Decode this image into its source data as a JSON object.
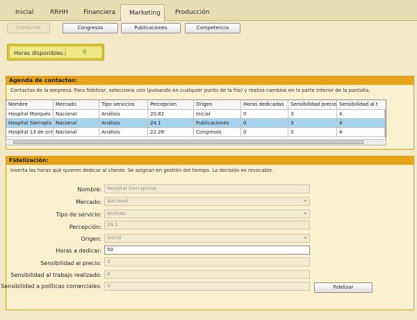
{
  "tabs": [
    "Inicial",
    "RRHH",
    "Financiera",
    "Marketing",
    "Producción"
  ],
  "subtabs": [
    "Contactos",
    "Congresos",
    "Publicaciones",
    "Competencia"
  ],
  "hours": {
    "label": "Horas disponibles:",
    "value": "0"
  },
  "agenda": {
    "title": "Agenda de contactos:",
    "description": "Contactos de la empresa. Para fidelizar, selecciona uno (pulsando en cualquier punto de la fila) y realiza cambios en la parte inferior de la pantalla.",
    "columns": [
      "Nombre",
      "Mercado",
      "Tipo servicios",
      "Percepcion",
      "Origen",
      "Horas dedicadas",
      "Sensibilidad precio",
      "Sensibilidad al t"
    ],
    "rows": [
      [
        "Hospital Marqués",
        "Nacional",
        "Análisis",
        "20.82",
        "Inicial",
        "0",
        "3",
        "4"
      ],
      [
        "Hospital Sierrapla",
        "Nacional",
        "Análisis",
        "24.1",
        "Publicaciones",
        "0",
        "3",
        "4"
      ],
      [
        "Hospital 13 de oct",
        "Nacional",
        "Análisis",
        "22.28",
        "Congresos",
        "0",
        "3",
        "4"
      ]
    ],
    "selected_row": 1
  },
  "fidelizacion": {
    "title": "Fidelización:",
    "description": "Inserta las horas que quieres dedicar al cliente. Se asignan en gestión del tiempo. La decisión es revocable.",
    "fields": {
      "nombre": {
        "label": "Nombre:",
        "value": "Hospital Sierraplana"
      },
      "mercado": {
        "label": "Mercado:",
        "value": "Nacional"
      },
      "tipo_servicio": {
        "label": "Tipo de servicio:",
        "value": "Análisis"
      },
      "percepcion": {
        "label": "Percepción:",
        "value": "24.1"
      },
      "origen": {
        "label": "Origen:",
        "value": "Inicial"
      },
      "horas": {
        "label": "Horas a dedicar:",
        "value": "50"
      },
      "sens_precio": {
        "label": "Sensibilidad al precio:",
        "value": "3"
      },
      "sens_trabajo": {
        "label": "Sensibilidad al trabajo realizado:",
        "value": "4"
      },
      "sens_politicas": {
        "label": "Sensibilidad a políticas comerciales:",
        "value": "3"
      }
    },
    "button": "Fidelizar"
  }
}
